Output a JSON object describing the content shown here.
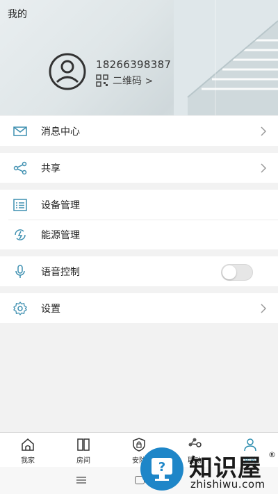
{
  "header": {
    "title": "我的",
    "phone": "18266398387",
    "qr_label": "二维码 >"
  },
  "menu": {
    "messages": "消息中心",
    "share": "共享",
    "devices": "设备管理",
    "energy": "能源管理",
    "voice": "语音控制",
    "settings": "设置"
  },
  "voice_toggle_on": false,
  "tabs": [
    {
      "label": "我家"
    },
    {
      "label": "房间"
    },
    {
      "label": "安防"
    },
    {
      "label": "联动"
    },
    {
      "label": "我的"
    }
  ],
  "watermark": {
    "title": "知识屋",
    "reg": "®",
    "domain": "zhishiwu.com"
  },
  "colors": {
    "accent": "#2f8fb0",
    "watermark_blue": "#1e86c8"
  }
}
